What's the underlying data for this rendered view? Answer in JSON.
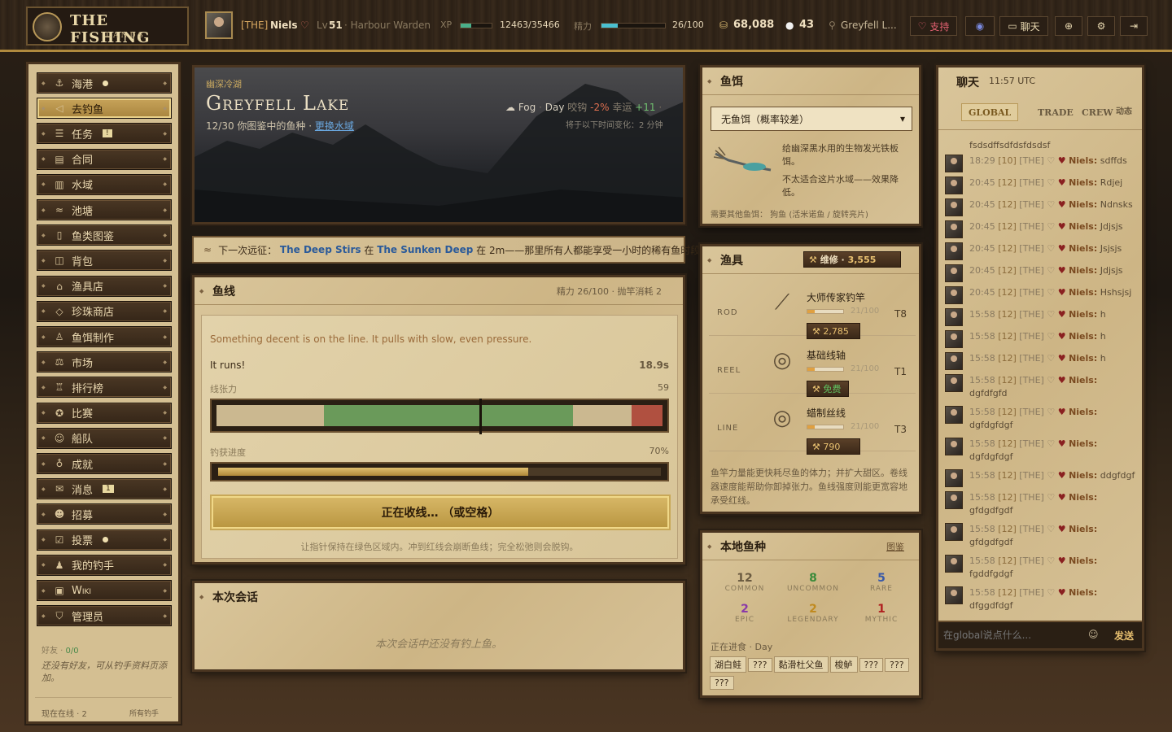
{
  "brand": {
    "title": "THE FISHING",
    "subtitle": "LANDS"
  },
  "player": {
    "tag": "[THE]",
    "name": "Niels",
    "lvl_prefix": "Lv",
    "level": "51",
    "role": "· Harbour Warden",
    "xp_label": "XP",
    "xp": "12463/35466",
    "xp_fraction": 0.35,
    "stamina_label": "精力",
    "stamina": "26/100",
    "stamina_fraction": 0.26,
    "coins": "68,088",
    "pearls": "43",
    "location": "Greyfell L..."
  },
  "topnav": {
    "support": "支持",
    "chat": "聊天"
  },
  "sidebar": {
    "items": [
      {
        "label": "海港",
        "icon": "anchor-icon",
        "glyph": "⚓",
        "dot": true
      },
      {
        "label": "去钓鱼",
        "icon": "fish-icon",
        "glyph": "◁",
        "active": true
      },
      {
        "label": "任务",
        "icon": "quest-icon",
        "glyph": "☰",
        "badge": "!"
      },
      {
        "label": "合同",
        "icon": "contract-icon",
        "glyph": "▤"
      },
      {
        "label": "水域",
        "icon": "map-icon",
        "glyph": "▥"
      },
      {
        "label": "池塘",
        "icon": "waves-icon",
        "glyph": "≈"
      },
      {
        "label": "鱼类图鉴",
        "icon": "book-icon",
        "glyph": "▯"
      },
      {
        "label": "背包",
        "icon": "box-icon",
        "glyph": "◫"
      },
      {
        "label": "渔具店",
        "icon": "shop-icon",
        "glyph": "⌂"
      },
      {
        "label": "珍珠商店",
        "icon": "gem-icon",
        "glyph": "◇"
      },
      {
        "label": "鱼饵制作",
        "icon": "flask-icon",
        "glyph": "♙"
      },
      {
        "label": "市场",
        "icon": "scale-icon",
        "glyph": "⚖"
      },
      {
        "label": "排行榜",
        "icon": "trophy-icon",
        "glyph": "♖"
      },
      {
        "label": "比赛",
        "icon": "medal-icon",
        "glyph": "✪"
      },
      {
        "label": "船队",
        "icon": "crew-icon",
        "glyph": "☺"
      },
      {
        "label": "成就",
        "icon": "award-icon",
        "glyph": "♁"
      },
      {
        "label": "消息",
        "icon": "mail-icon",
        "glyph": "✉",
        "badge": "1"
      },
      {
        "label": "招募",
        "icon": "recruit-icon",
        "glyph": "☻"
      },
      {
        "label": "投票",
        "icon": "vote-icon",
        "glyph": "☑",
        "dot": true
      },
      {
        "label": "我的钓手",
        "icon": "user-icon",
        "glyph": "♟"
      },
      {
        "label": "Wiki",
        "icon": "wiki-icon",
        "glyph": "▣"
      },
      {
        "label": "管理员",
        "icon": "shield-icon",
        "glyph": "⛉"
      }
    ],
    "friends_label": "好友 ·",
    "friends_count": "0/0",
    "friends_empty": "还没有好友，可从钓手资料页添加。",
    "online": "现在在线 · 2",
    "all_anglers": "所有钓手"
  },
  "lake": {
    "region": "幽深冷湖",
    "name": "Greyfell Lake",
    "progress": "12/30",
    "progress_text": "你图鉴中的鱼种 ·",
    "change_water": "更换水域",
    "weather": "Fog",
    "time": "Day",
    "bite_label": "咬钩",
    "bite": "-2%",
    "luck_label": "幸运",
    "luck": "+11",
    "change_note": "将于以下时间变化：2 分钟"
  },
  "expedition": {
    "prefix": "下一次远征：",
    "event": "The Deep Stirs",
    "mid": "在",
    "place": "The Sunken Deep",
    "time": "在 2m",
    "suffix": "——那里所有人都能享受一小时的稀有鱼时段。"
  },
  "line": {
    "title": "鱼线",
    "stamina_info": "精力 26/100 · 抛竿消耗 2",
    "status": "Something decent is on the line. It pulls with slow, even pressure.",
    "runs": "It runs!",
    "timer": "18.9s",
    "tension_label": "线张力",
    "tension_value": "59",
    "tension_fraction": 0.59,
    "progress_label": "钓获进度",
    "progress_value": "70%",
    "progress_fraction": 0.7,
    "reel_button": "正在收线…  （或空格）",
    "hint": "让指针保持在绿色区域内。冲到红线会崩断鱼线；完全松弛则会脱钩。"
  },
  "session": {
    "title": "本次会话",
    "empty": "本次会话中还没有钓上鱼。"
  },
  "bait": {
    "title": "鱼饵",
    "selected": "无鱼饵（概率较差）",
    "desc1": "给幽深黑水用的生物发光铁板饵。",
    "desc2": "不太适合这片水域——效果降低。",
    "need": "需要其他鱼饵： 狗鱼 (活米诺鱼 / 旋转亮片)"
  },
  "gear": {
    "title": "渔具",
    "repair": "维修 ·",
    "repair_cost": "3,555",
    "rows": [
      {
        "kind": "ROD",
        "name": "大师传家钓竿",
        "dur": "21/100",
        "dur_fraction": 0.21,
        "tier": "T8",
        "cost": "2,785",
        "icon": "rod-icon"
      },
      {
        "kind": "REEL",
        "name": "基础线轴",
        "dur": "21/100",
        "dur_fraction": 0.21,
        "tier": "T1",
        "cost": "免费",
        "icon": "reel-icon"
      },
      {
        "kind": "LINE",
        "name": "蜡制丝线",
        "dur": "21/100",
        "dur_fraction": 0.21,
        "tier": "T3",
        "cost": "790",
        "icon": "spool-icon"
      }
    ],
    "note": "鱼竿力量能更快耗尽鱼的体力；并扩大甜区。卷线器速度能帮助你卸掉张力。鱼线强度则能更宽容地承受红线。"
  },
  "species": {
    "title": "本地鱼种",
    "link": "图鉴",
    "counts": [
      {
        "n": "12",
        "label": "COMMON",
        "color": "#6a5a40"
      },
      {
        "n": "8",
        "label": "UNCOMMON",
        "color": "#3a8a3a"
      },
      {
        "n": "5",
        "label": "RARE",
        "color": "#3a5aa8"
      },
      {
        "n": "2",
        "label": "EPIC",
        "color": "#8a3aa8"
      },
      {
        "n": "2",
        "label": "LEGENDARY",
        "color": "#c08a20"
      },
      {
        "n": "1",
        "label": "MYTHIC",
        "color": "#b02020"
      }
    ],
    "feeding": "正在进食 · Day",
    "tags": [
      "湖白鲑",
      "???",
      "黏滑杜父鱼",
      "梭鲈",
      "???",
      "???",
      "???"
    ]
  },
  "chat": {
    "title": "聊天",
    "time": "11:57 UTC",
    "tabs": [
      "GLOBAL",
      "TRADE",
      "CREW",
      "动态"
    ],
    "placeholder": "在global说点什么...",
    "send": "发送",
    "top_line": "fsdsdffsdfdsfdsdsf",
    "messages": [
      {
        "t": "18:29",
        "lv": "[10]",
        "tag": "[THE]",
        "name": "Niels:",
        "text": "sdffds"
      },
      {
        "t": "20:45",
        "lv": "[12]",
        "tag": "[THE]",
        "name": "Niels:",
        "text": "Rdjej"
      },
      {
        "t": "20:45",
        "lv": "[12]",
        "tag": "[THE]",
        "name": "Niels:",
        "text": "Ndnsks"
      },
      {
        "t": "20:45",
        "lv": "[12]",
        "tag": "[THE]",
        "name": "Niels:",
        "text": "Jdjsjs"
      },
      {
        "t": "20:45",
        "lv": "[12]",
        "tag": "[THE]",
        "name": "Niels:",
        "text": "Jsjsjs"
      },
      {
        "t": "20:45",
        "lv": "[12]",
        "tag": "[THE]",
        "name": "Niels:",
        "text": "Jdjsjs"
      },
      {
        "t": "20:45",
        "lv": "[12]",
        "tag": "[THE]",
        "name": "Niels:",
        "text": "Hshsjsj"
      },
      {
        "t": "15:58",
        "lv": "[12]",
        "tag": "[THE]",
        "name": "Niels:",
        "text": "h"
      },
      {
        "t": "15:58",
        "lv": "[12]",
        "tag": "[THE]",
        "name": "Niels:",
        "text": "h"
      },
      {
        "t": "15:58",
        "lv": "[12]",
        "tag": "[THE]",
        "name": "Niels:",
        "text": "h"
      },
      {
        "t": "15:58",
        "lv": "[12]",
        "tag": "[THE]",
        "name": "Niels:",
        "text": "dgfdfgfd"
      },
      {
        "t": "15:58",
        "lv": "[12]",
        "tag": "[THE]",
        "name": "Niels:",
        "text": "dgfdgfdgf"
      },
      {
        "t": "15:58",
        "lv": "[12]",
        "tag": "[THE]",
        "name": "Niels:",
        "text": "dgfdgfdgf"
      },
      {
        "t": "15:58",
        "lv": "[12]",
        "tag": "[THE]",
        "name": "Niels:",
        "text": "ddgfdgf"
      },
      {
        "t": "15:58",
        "lv": "[12]",
        "tag": "[THE]",
        "name": "Niels:",
        "text": "gfdgdfgdf"
      },
      {
        "t": "15:58",
        "lv": "[12]",
        "tag": "[THE]",
        "name": "Niels:",
        "text": "gfdgdfgdf"
      },
      {
        "t": "15:58",
        "lv": "[12]",
        "tag": "[THE]",
        "name": "Niels:",
        "text": "fgddfgdgf"
      },
      {
        "t": "15:58",
        "lv": "[12]",
        "tag": "[THE]",
        "name": "Niels:",
        "text": "dfggdfdgf"
      }
    ]
  }
}
